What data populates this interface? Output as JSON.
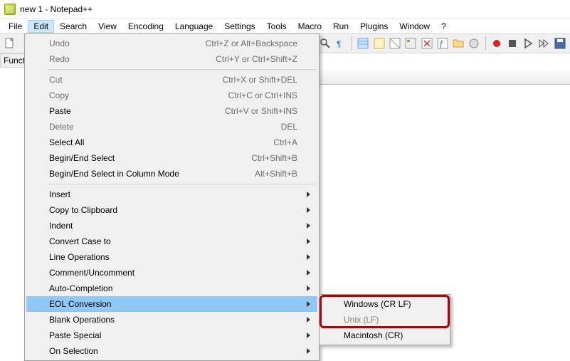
{
  "title": "new 1 - Notepad++",
  "menubar": [
    "File",
    "Edit",
    "Search",
    "View",
    "Encoding",
    "Language",
    "Settings",
    "Tools",
    "Macro",
    "Run",
    "Plugins",
    "Window",
    "?"
  ],
  "active_menu": "Edit",
  "side_label": "Funct",
  "edit_menu": {
    "undo": {
      "label": "Undo",
      "shortcut": "Ctrl+Z or Alt+Backspace"
    },
    "redo": {
      "label": "Redo",
      "shortcut": "Ctrl+Y or Ctrl+Shift+Z"
    },
    "cut": {
      "label": "Cut",
      "shortcut": "Ctrl+X or Shift+DEL"
    },
    "copy": {
      "label": "Copy",
      "shortcut": "Ctrl+C or Ctrl+INS"
    },
    "paste": {
      "label": "Paste",
      "shortcut": "Ctrl+V or Shift+INS"
    },
    "delete": {
      "label": "Delete",
      "shortcut": "DEL"
    },
    "select_all": {
      "label": "Select All",
      "shortcut": "Ctrl+A"
    },
    "begin_end": {
      "label": "Begin/End Select",
      "shortcut": "Ctrl+Shift+B"
    },
    "begin_end_col": {
      "label": "Begin/End Select in Column Mode",
      "shortcut": "Alt+Shift+B"
    },
    "insert": {
      "label": "Insert"
    },
    "copy_clip": {
      "label": "Copy to Clipboard"
    },
    "indent": {
      "label": "Indent"
    },
    "convert": {
      "label": "Convert Case to"
    },
    "line_ops": {
      "label": "Line Operations"
    },
    "comment": {
      "label": "Comment/Uncomment"
    },
    "autocomp": {
      "label": "Auto-Completion"
    },
    "eol": {
      "label": "EOL Conversion"
    },
    "blank": {
      "label": "Blank Operations"
    },
    "paste_special": {
      "label": "Paste Special"
    },
    "on_selection": {
      "label": "On Selection"
    }
  },
  "eol_submenu": {
    "windows": "Windows (CR LF)",
    "unix": "Unix (LF)",
    "mac": "Macintosh (CR)"
  }
}
